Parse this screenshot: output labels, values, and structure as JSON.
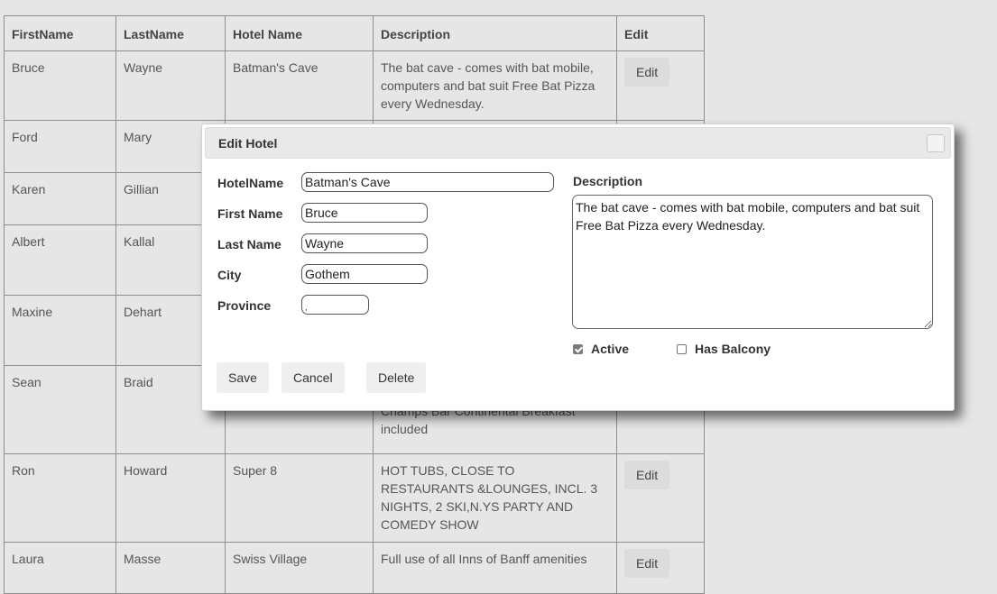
{
  "table": {
    "headers": [
      "FirstName",
      "LastName",
      "Hotel Name",
      "Description",
      "Edit"
    ],
    "rows": [
      {
        "first": "Bruce",
        "last": "Wayne",
        "hotel": "Batman's Cave",
        "description": "The bat cave - comes with bat mobile, computers and bat suit Free Bat Pizza every Wednesday.",
        "edit": "Edit"
      },
      {
        "first": "Ford",
        "last": "Mary",
        "hotel": "",
        "description": "",
        "edit": ""
      },
      {
        "first": "Karen",
        "last": "Gillian",
        "hotel": "",
        "description": "",
        "edit": ""
      },
      {
        "first": "Albert",
        "last": "Kallal",
        "hotel": "",
        "description": "",
        "edit": ""
      },
      {
        "first": "Maxine",
        "last": "Dehart",
        "hotel": "",
        "description": "",
        "edit": ""
      },
      {
        "first": "Sean",
        "last": "Braid",
        "hotel": "",
        "description": "Champs Bar Continental Breakfast included",
        "edit": ""
      },
      {
        "first": "Ron",
        "last": "Howard",
        "hotel": "Super 8",
        "description": "HOT TUBS, CLOSE TO RESTAURANTS &LOUNGES, INCL. 3 NIGHTS, 2 SKI,N.YS PARTY AND COMEDY SHOW",
        "edit": "Edit"
      },
      {
        "first": "Laura",
        "last": "Masse",
        "hotel": "Swiss Village",
        "description": "Full use of all Inns of Banff amenities",
        "edit": "Edit"
      }
    ]
  },
  "dialog": {
    "title": "Edit Hotel",
    "fields": {
      "hotel_name": {
        "label": "HotelName",
        "value": "Batman's Cave"
      },
      "first_name": {
        "label": "First Name",
        "value": "Bruce"
      },
      "last_name": {
        "label": "Last Name",
        "value": "Wayne"
      },
      "city": {
        "label": "City",
        "value": "Gothem"
      },
      "province": {
        "label": "Province",
        "value": ","
      }
    },
    "description": {
      "label": "Description",
      "value": "The bat cave - comes with bat mobile, computers and bat suit\nFree Bat Pizza every Wednesday."
    },
    "active": {
      "label": "Active",
      "checked": true
    },
    "has_balcony": {
      "label": "Has Balcony",
      "checked": false
    },
    "buttons": {
      "save": "Save",
      "cancel": "Cancel",
      "delete": "Delete"
    }
  }
}
